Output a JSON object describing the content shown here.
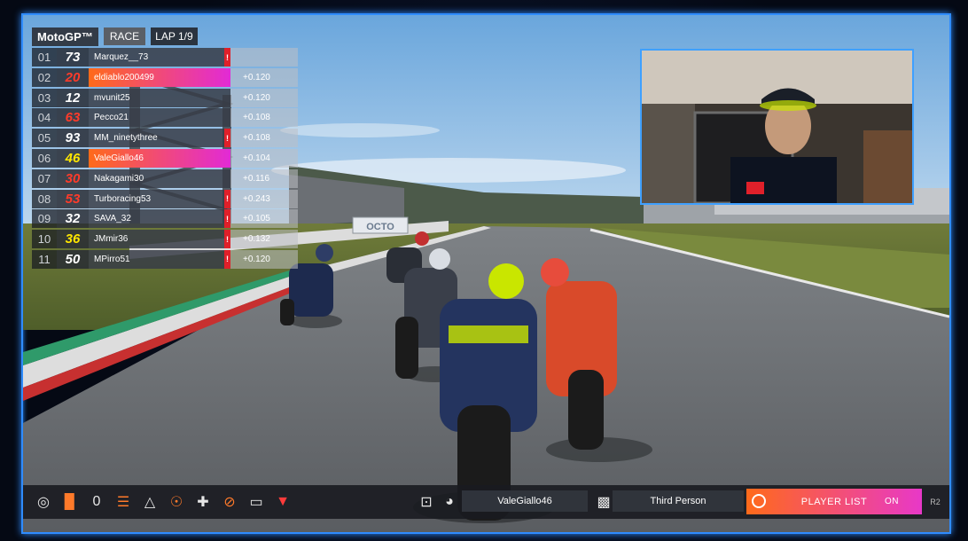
{
  "hud": {
    "brand": "MotoGP™",
    "session": "RACE",
    "lap": "LAP 1/9"
  },
  "standings": [
    {
      "pos": "01",
      "num": "73",
      "name": "Marquez__73",
      "gap": "",
      "flag": true,
      "highlight": false
    },
    {
      "pos": "02",
      "num": "20",
      "name": "eldiablo200499",
      "gap": "+0.120",
      "flag": false,
      "highlight": true
    },
    {
      "pos": "03",
      "num": "12",
      "name": "mvunit25",
      "gap": "+0.120",
      "flag": false,
      "highlight": false
    },
    {
      "pos": "04",
      "num": "63",
      "name": "Pecco21",
      "gap": "+0.108",
      "flag": false,
      "highlight": false
    },
    {
      "pos": "05",
      "num": "93",
      "name": "MM_ninetythree",
      "gap": "+0.108",
      "flag": true,
      "highlight": false
    },
    {
      "pos": "06",
      "num": "46",
      "name": "ValeGiallo46",
      "gap": "+0.104",
      "flag": false,
      "highlight": true
    },
    {
      "pos": "07",
      "num": "30",
      "name": "Nakagami30",
      "gap": "+0.116",
      "flag": false,
      "highlight": false
    },
    {
      "pos": "08",
      "num": "53",
      "name": "Turboracing53",
      "gap": "+0.243",
      "flag": true,
      "highlight": false
    },
    {
      "pos": "09",
      "num": "32",
      "name": "SAVA_32",
      "gap": "+0.105",
      "flag": true,
      "highlight": false
    },
    {
      "pos": "10",
      "num": "36",
      "name": "JMmir36",
      "gap": "+0.132",
      "flag": true,
      "highlight": false
    },
    {
      "pos": "11",
      "num": "50",
      "name": "MPirro51",
      "gap": "+0.120",
      "flag": true,
      "highlight": false
    }
  ],
  "number_colors": [
    "#ffffff",
    "#ff3b2a",
    "#ffffff",
    "#ff3b2a",
    "#ffffff",
    "#ffe600",
    "#ff3b2a",
    "#ff3b2a",
    "#ffffff",
    "#ffe600",
    "#ffffff"
  ],
  "scene": {
    "sign": "OCTO"
  },
  "toolbar": {
    "counter": "0",
    "rider": "ValeGiallo46",
    "camera_view": "Third Person",
    "player_list": "PLAYER LIST",
    "on_label": "ON",
    "r2_label": "R2"
  },
  "colors": {
    "frame": "#2f8cff",
    "accent_start": "#ff6a1a",
    "accent_end": "#e22ad6",
    "flag": "#e0202a"
  }
}
